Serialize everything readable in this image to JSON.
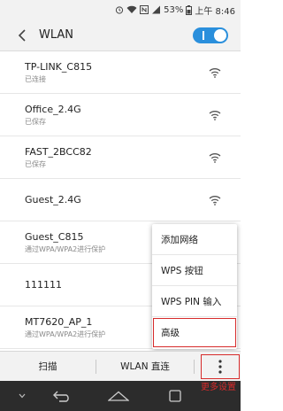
{
  "status_bar": {
    "battery_percent": "53%",
    "time": "上午 8:46"
  },
  "header": {
    "title": "WLAN",
    "toggle_on": true
  },
  "networks": [
    {
      "ssid": "TP-LINK_C815",
      "status": "已连接"
    },
    {
      "ssid": "Office_2.4G",
      "status": "已保存"
    },
    {
      "ssid": "FAST_2BCC82",
      "status": "已保存"
    },
    {
      "ssid": "Guest_2.4G",
      "status": ""
    },
    {
      "ssid": "Guest_C815",
      "status": "通过WPA/WPA2进行保护"
    },
    {
      "ssid": "111111",
      "status": ""
    },
    {
      "ssid": "MT7620_AP_1",
      "status": "通过WPA/WPA2进行保护"
    }
  ],
  "menu": {
    "items": [
      "添加网络",
      "WPS 按钮",
      "WPS PIN 输入",
      "高级"
    ]
  },
  "action_bar": {
    "scan": "扫描",
    "wifi_direct": "WLAN 直连",
    "more_annotation": "更多设置"
  },
  "colors": {
    "accent": "#2a8fdc",
    "annotation": "#d62b2b"
  }
}
